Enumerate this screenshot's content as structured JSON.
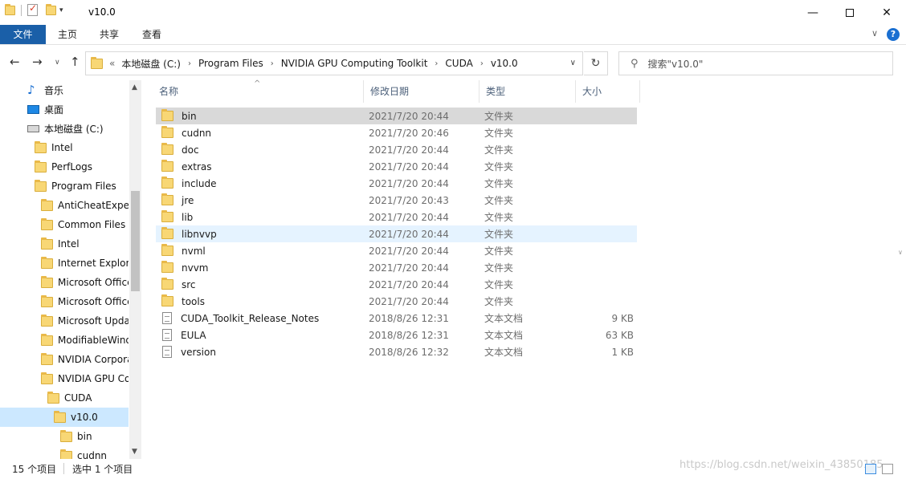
{
  "window": {
    "title": "v10.0",
    "minimize": "—",
    "close": "✕"
  },
  "ribbon": {
    "tabs": [
      "文件",
      "主页",
      "共享",
      "查看"
    ],
    "help": "?"
  },
  "nav": {
    "back": "←",
    "forward": "→",
    "recent": "∨",
    "up": "↑",
    "breadcrumb_prefix": "«",
    "breadcrumbs": [
      "本地磁盘 (C:)",
      "Program Files",
      "NVIDIA GPU Computing Toolkit",
      "CUDA",
      "v10.0"
    ],
    "refresh": "↻",
    "search_placeholder": "搜索\"v10.0\""
  },
  "sidebar": {
    "items": [
      {
        "label": "音乐",
        "icon": "music-icon"
      },
      {
        "label": "桌面",
        "icon": "desktop-icon"
      },
      {
        "label": "本地磁盘 (C:)",
        "icon": "drive-icon"
      },
      {
        "label": "Intel",
        "icon": "folder-icon"
      },
      {
        "label": "PerfLogs",
        "icon": "folder-icon"
      },
      {
        "label": "Program Files",
        "icon": "folder-icon"
      },
      {
        "label": "AntiCheatExpert",
        "icon": "folder-icon"
      },
      {
        "label": "Common Files",
        "icon": "folder-icon"
      },
      {
        "label": "Intel",
        "icon": "folder-icon"
      },
      {
        "label": "Internet Explorer",
        "icon": "folder-icon"
      },
      {
        "label": "Microsoft Office",
        "icon": "folder-icon"
      },
      {
        "label": "Microsoft Office",
        "icon": "folder-icon"
      },
      {
        "label": "Microsoft Update",
        "icon": "folder-icon"
      },
      {
        "label": "ModifiableWindows",
        "icon": "folder-icon"
      },
      {
        "label": "NVIDIA Corporation",
        "icon": "folder-icon"
      },
      {
        "label": "NVIDIA GPU Computing",
        "icon": "folder-icon"
      },
      {
        "label": "CUDA",
        "icon": "folder-icon"
      },
      {
        "label": "v10.0",
        "icon": "folder-icon",
        "selected": true
      },
      {
        "label": "bin",
        "icon": "folder-icon"
      },
      {
        "label": "cudnn",
        "icon": "folder-icon"
      }
    ]
  },
  "columns": {
    "name": "名称",
    "date": "修改日期",
    "type": "类型",
    "size": "大小"
  },
  "files": [
    {
      "name": "bin",
      "date": "2021/7/20 20:44",
      "type": "文件夹",
      "size": "",
      "kind": "folder",
      "state": "selected"
    },
    {
      "name": "cudnn",
      "date": "2021/7/20 20:46",
      "type": "文件夹",
      "size": "",
      "kind": "folder"
    },
    {
      "name": "doc",
      "date": "2021/7/20 20:44",
      "type": "文件夹",
      "size": "",
      "kind": "folder"
    },
    {
      "name": "extras",
      "date": "2021/7/20 20:44",
      "type": "文件夹",
      "size": "",
      "kind": "folder"
    },
    {
      "name": "include",
      "date": "2021/7/20 20:44",
      "type": "文件夹",
      "size": "",
      "kind": "folder"
    },
    {
      "name": "jre",
      "date": "2021/7/20 20:43",
      "type": "文件夹",
      "size": "",
      "kind": "folder"
    },
    {
      "name": "lib",
      "date": "2021/7/20 20:44",
      "type": "文件夹",
      "size": "",
      "kind": "folder"
    },
    {
      "name": "libnvvp",
      "date": "2021/7/20 20:44",
      "type": "文件夹",
      "size": "",
      "kind": "folder",
      "state": "hover"
    },
    {
      "name": "nvml",
      "date": "2021/7/20 20:44",
      "type": "文件夹",
      "size": "",
      "kind": "folder"
    },
    {
      "name": "nvvm",
      "date": "2021/7/20 20:44",
      "type": "文件夹",
      "size": "",
      "kind": "folder"
    },
    {
      "name": "src",
      "date": "2021/7/20 20:44",
      "type": "文件夹",
      "size": "",
      "kind": "folder"
    },
    {
      "name": "tools",
      "date": "2021/7/20 20:44",
      "type": "文件夹",
      "size": "",
      "kind": "folder"
    },
    {
      "name": "CUDA_Toolkit_Release_Notes",
      "date": "2018/8/26 12:31",
      "type": "文本文档",
      "size": "9 KB",
      "kind": "file"
    },
    {
      "name": "EULA",
      "date": "2018/8/26 12:31",
      "type": "文本文档",
      "size": "63 KB",
      "kind": "file"
    },
    {
      "name": "version",
      "date": "2018/8/26 12:32",
      "type": "文本文档",
      "size": "1 KB",
      "kind": "file"
    }
  ],
  "status": {
    "count": "15 个项目",
    "selected": "选中 1 个项目",
    "watermark": "https://blog.csdn.net/weixin_43850185"
  }
}
